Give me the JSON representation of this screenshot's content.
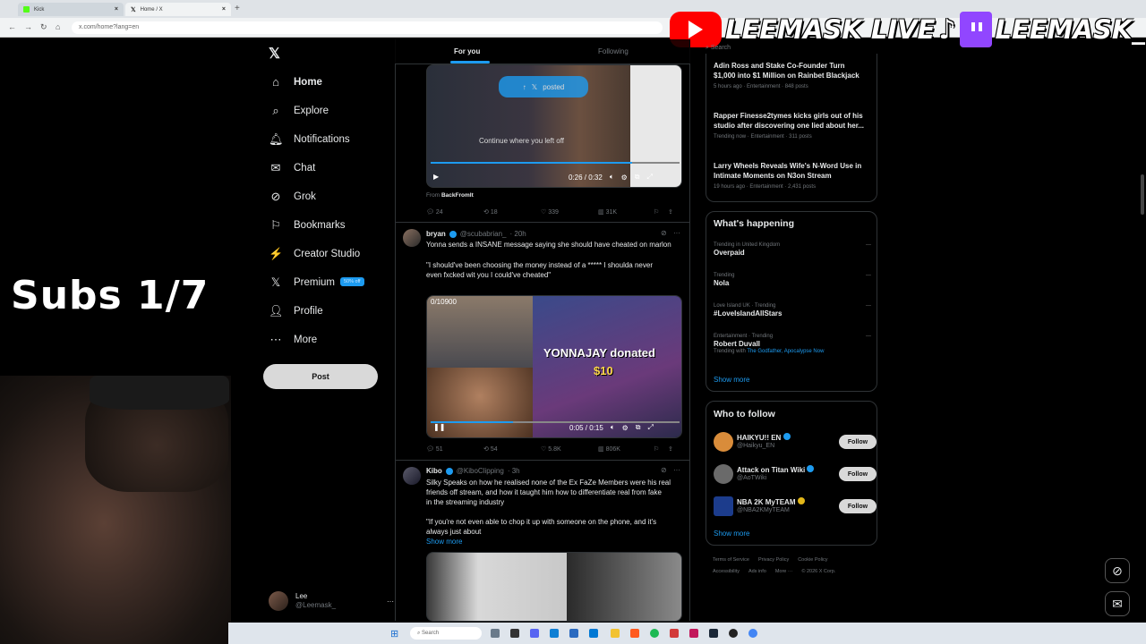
{
  "browser": {
    "tabs": [
      {
        "title": "Kick",
        "color": "#53fc18"
      },
      {
        "title": "Home / X",
        "color": "#000000"
      }
    ],
    "url": "x.com/home?lang=en"
  },
  "stream_overlay": {
    "brand_text_1": "LEEMASK LIVE",
    "brand_text_2": "LEEMASK_",
    "subs_goal": "Subs 1/7"
  },
  "sidebar": {
    "items": [
      {
        "label": "Home",
        "icon": "home-icon"
      },
      {
        "label": "Explore",
        "icon": "search-icon"
      },
      {
        "label": "Notifications",
        "icon": "bell-icon"
      },
      {
        "label": "Chat",
        "icon": "mail-icon"
      },
      {
        "label": "Grok",
        "icon": "grok-icon"
      },
      {
        "label": "Bookmarks",
        "icon": "bookmark-icon"
      },
      {
        "label": "Creator Studio",
        "icon": "creator-studio-icon"
      },
      {
        "label": "Premium",
        "icon": "x-logo-icon"
      },
      {
        "label": "Profile",
        "icon": "person-icon"
      },
      {
        "label": "More",
        "icon": "more-circle-icon"
      }
    ],
    "premium_badge": "50% off",
    "post_label": "Post",
    "account": {
      "name": "Lee",
      "handle": "@Leemask_"
    }
  },
  "feed": {
    "tabs": [
      "For you",
      "Following"
    ],
    "post_overlay_label": "posted",
    "tweet0": {
      "video_caption": "Continue where you left off",
      "time": "0:26 / 0:32",
      "from_label": "From",
      "from_source": "BackFromIt",
      "replies": "24",
      "reposts": "18",
      "likes": "339",
      "views": "31K"
    },
    "tweet1": {
      "name": "bryan",
      "handle": "@scubabrian_",
      "time": "· 20h",
      "line1": "Yonna sends a INSANE message saying she should have cheated on marlon",
      "line2": "\"I should've been choosing the money instead of a ***** I shoulda never",
      "line3": "even fxcked wit you I could've cheated\"",
      "donation_counter": "0/10900",
      "donation_text": "YONNAJAY donated",
      "donation_amount": "$10",
      "time_code": "0:05 / 0:15",
      "replies": "51",
      "reposts": "54",
      "likes": "5.8K",
      "views": "806K"
    },
    "tweet2": {
      "name": "Kibo",
      "handle": "@KiboClipping",
      "time": "· 3h",
      "line1": "Silky Speaks on how he realised none of the Ex FaZe Members were his real",
      "line2": "friends off stream, and how it taught him how to differentiate real from fake",
      "line3": "in the streaming industry",
      "line4": "\"If you're not even able to chop it up with someone on the phone, and it's",
      "line5": "always just about",
      "show_more": "Show more"
    }
  },
  "right": {
    "search_placeholder": "Search",
    "news": [
      {
        "title1": "Adin Ross and Stake Co-Founder Turn",
        "title2": "$1,000 into $1 Million on Rainbet Blackjack",
        "meta": "5 hours ago · Entertainment · 848 posts"
      },
      {
        "title1": "Rapper Finesse2tymes kicks girls out of his",
        "title2": "studio after discovering one lied about her...",
        "meta": "Trending now · Entertainment · 311 posts"
      },
      {
        "title1": "Larry Wheels Reveals Wife's N-Word Use in",
        "title2": "Intimate Moments on N3on Stream",
        "meta": "19 hours ago · Entertainment · 2,431 posts"
      }
    ],
    "whats_happening": "What's happening",
    "trends": [
      {
        "context": "Trending in United Kingdom",
        "name": "Overpaid"
      },
      {
        "context": "Trending",
        "name": "Nola"
      },
      {
        "context": "Love Island UK · Trending",
        "name": "#LoveIslandAllStars"
      },
      {
        "context": "Entertainment · Trending",
        "name": "Robert Duvall",
        "extra_prefix": "Trending with",
        "extra_links": "The Godfather, Apocalypse Now"
      }
    ],
    "show_more": "Show more",
    "who_to_follow": "Who to follow",
    "follow_suggestions": [
      {
        "name": "HAIKYU!! EN",
        "handle": "@Haikyu_EN",
        "avatar_color": "#d98c3a"
      },
      {
        "name": "Attack on Titan Wiki",
        "handle": "@AoTWiki",
        "avatar_color": "#6a6a6a"
      },
      {
        "name": "NBA 2K MyTEAM",
        "handle": "@NBA2KMyTEAM",
        "avatar_color": "#1c3c8c"
      }
    ],
    "follow_label": "Follow",
    "show_more_2": "Show more",
    "footer": {
      "links_row1": [
        "Terms of Service",
        "Privacy Policy",
        "Cookie Policy"
      ],
      "links_row2": [
        "Accessibility",
        "Ads info",
        "More ···",
        "© 2026 X Corp."
      ]
    }
  },
  "taskbar": {
    "search_label": "Search"
  },
  "colors": {
    "accent": "#1d9bf0",
    "background": "#000000",
    "youtube": "#ff0000",
    "twitch": "#9146ff"
  }
}
